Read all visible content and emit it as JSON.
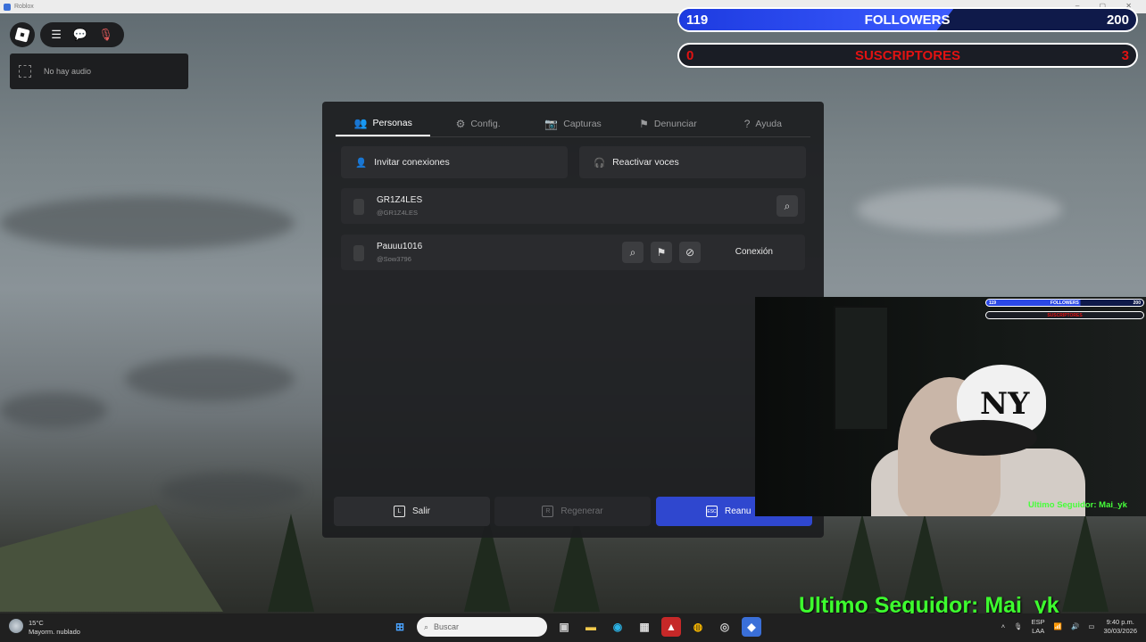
{
  "window": {
    "title": "Roblox"
  },
  "hud": {
    "audio_status": "No hay audio"
  },
  "overlay": {
    "followers": {
      "current": "119",
      "label": "FOLLOWERS",
      "goal": "200",
      "progress": 0.6
    },
    "subscribers": {
      "current": "0",
      "label": "SUSCRIPTORES",
      "goal": "3"
    },
    "mini_followers": {
      "current": "119",
      "label": "FOLLOWERS",
      "goal": "200"
    },
    "mini_subscribers": {
      "label": "SUSCRIPTORES"
    },
    "cam_last_follower": "Ultimo Seguidor: Mai_yk",
    "last_follower": "Ultimo Seguidor: Mai_yk"
  },
  "menu": {
    "tabs": [
      {
        "label": "Personas",
        "active": true
      },
      {
        "label": "Config."
      },
      {
        "label": "Capturas"
      },
      {
        "label": "Denunciar"
      },
      {
        "label": "Ayuda"
      }
    ],
    "invite_label": "Invitar conexiones",
    "voices_label": "Reactivar voces",
    "players": [
      {
        "name": "GR1Z4LES",
        "handle": "@GR1Z4LES"
      },
      {
        "name": "Pauuu1016",
        "handle": "@Sow3796",
        "action": "Conexión"
      }
    ],
    "leave_label": "Salir",
    "leave_key": "L",
    "reset_label": "Regenerar",
    "reset_key": "R",
    "resume_label": "Reanu",
    "resume_key": "ESC"
  },
  "taskbar": {
    "weather_temp": "15°C",
    "weather_desc": "Mayorm. nublado",
    "search_placeholder": "Buscar",
    "lang": "ESP",
    "lang2": "LAA",
    "time": "9:40 p.m.",
    "date": "30/03/2026"
  }
}
